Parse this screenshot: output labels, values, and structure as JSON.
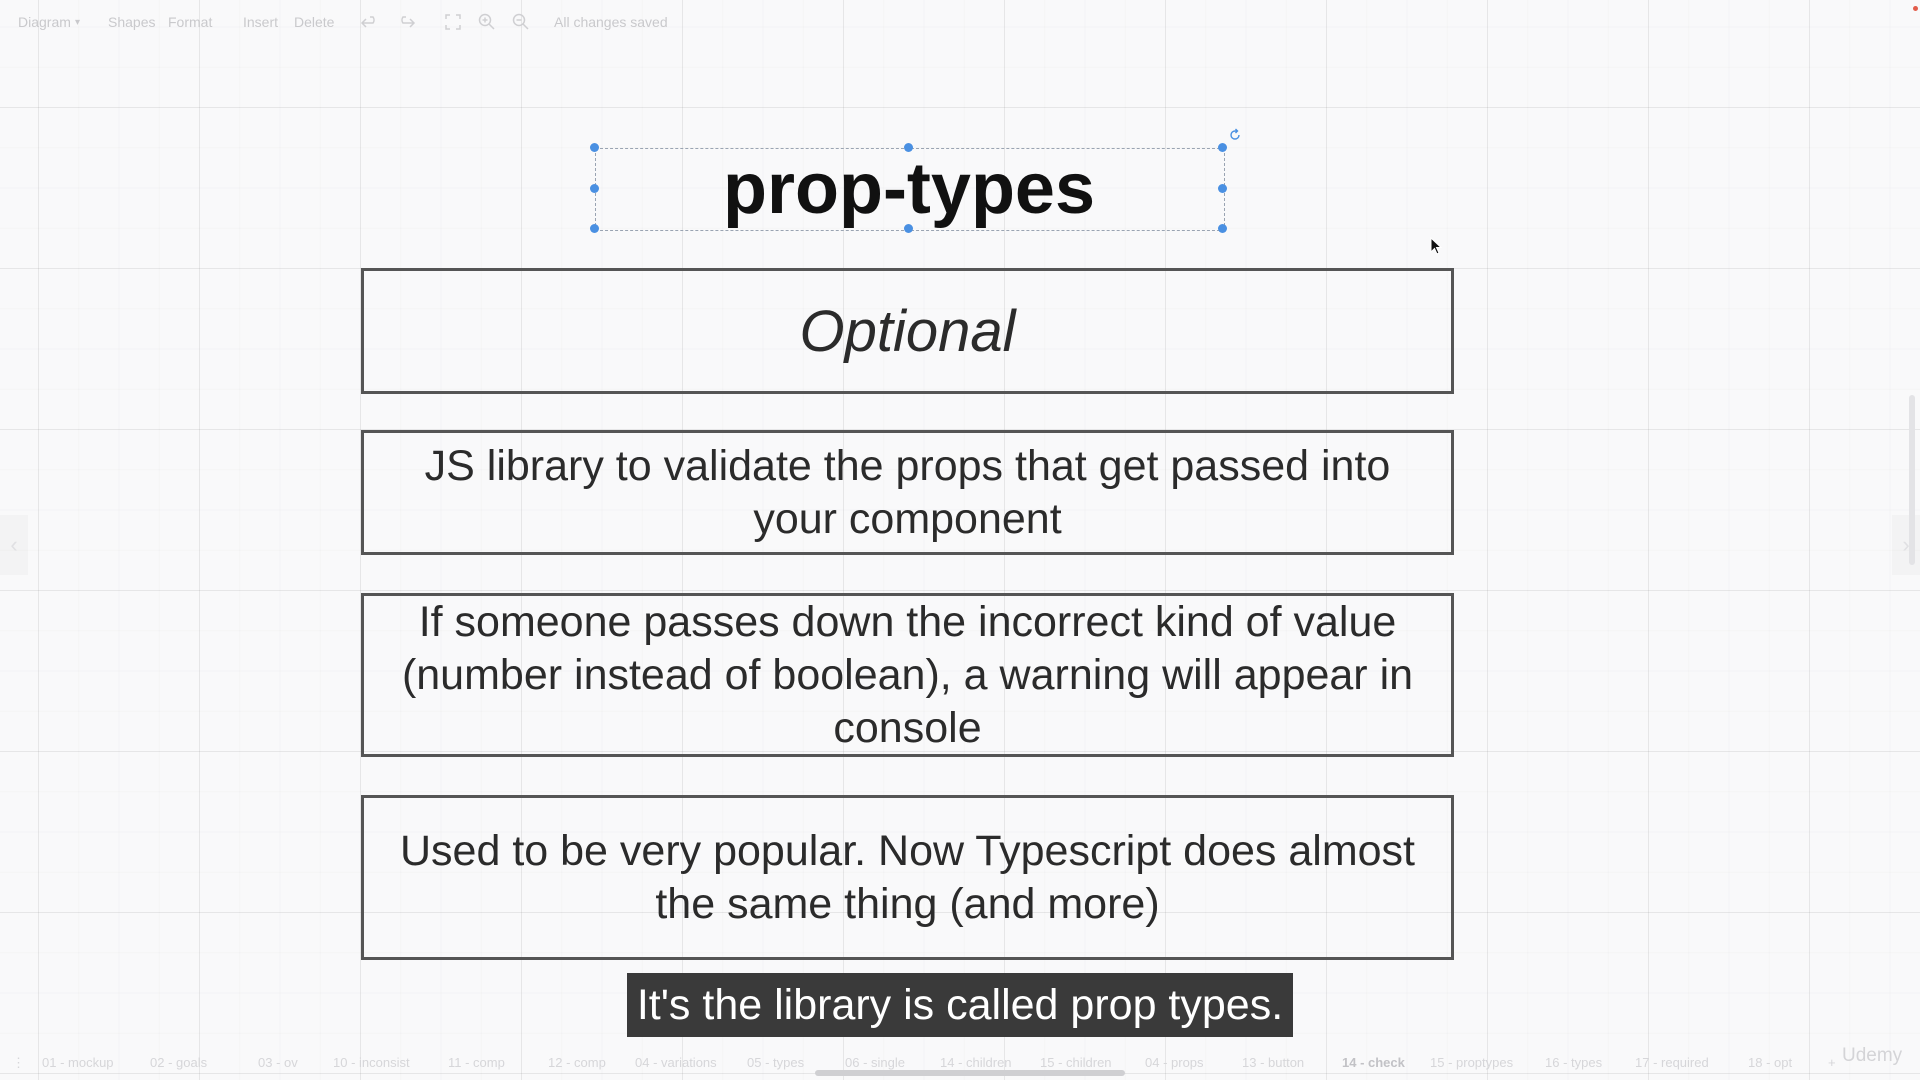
{
  "toolbar": {
    "diagram_label": "Diagram",
    "shapes_label": "Shapes",
    "format_label": "Format",
    "insert_label": "Insert",
    "delete_label": "Delete",
    "status": "All changes saved",
    "icons": [
      "undo-icon",
      "redo-icon",
      "fullscreen-icon",
      "zoom-in-icon",
      "zoom-out-icon"
    ]
  },
  "slide": {
    "title": "prop-types",
    "boxes": [
      "Optional",
      "JS library to validate the props that get passed into your component",
      "If someone passes down the incorrect kind of value (number instead of boolean), a warning will appear in console",
      "Used to be very popular. Now Typescript does almost the same thing (and more)"
    ]
  },
  "caption": "It's the library is called prop types.",
  "page_tabs": [
    "01 - mockup",
    "02 - goals",
    "03 - ov",
    "10 - inconsist",
    "11 - comp",
    "12 - comp",
    "04 - variations",
    "05 - types",
    "06 - single",
    "14 - children",
    "15 - children",
    "04 - props",
    "13 - button",
    "14 - check",
    "15 - proptypes",
    "16 - types",
    "17 - required",
    "18 - opt"
  ],
  "active_tab": "14 - check",
  "brand": "Udemy",
  "colors": {
    "selection_handle": "#4a90e2",
    "box_border": "#555555",
    "caption_bg": "#3a3a3a"
  }
}
